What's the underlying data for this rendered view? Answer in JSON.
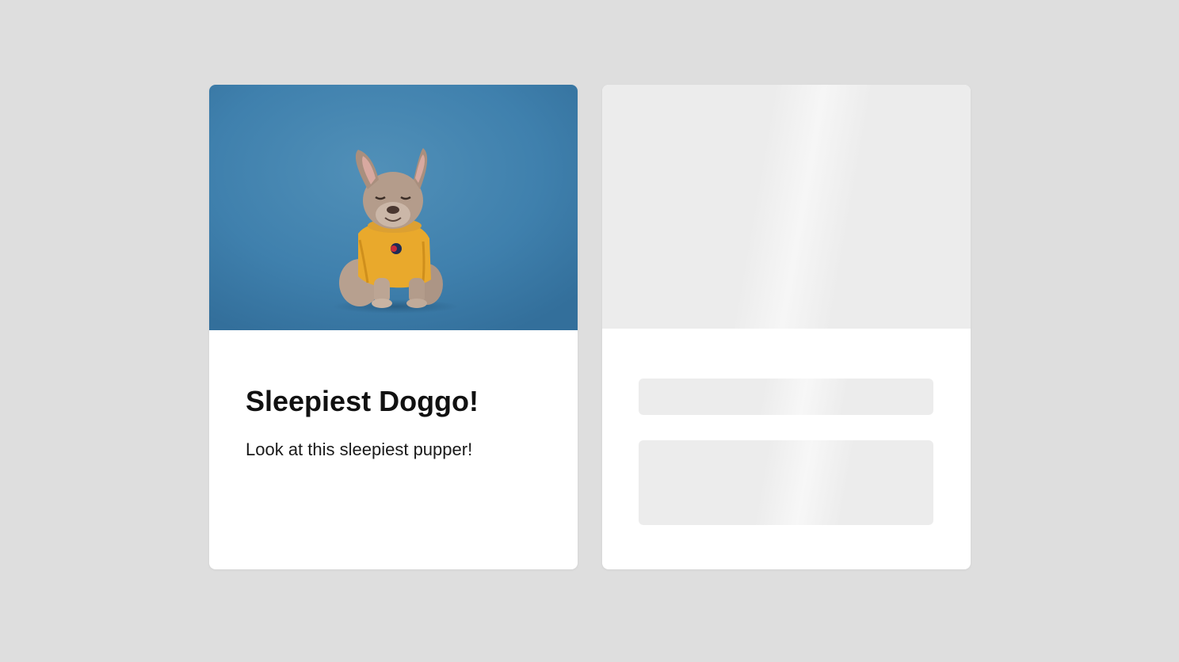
{
  "card": {
    "title": "Sleepiest Doggo!",
    "description": "Look at this sleepiest pupper!",
    "image": {
      "subject": "dog-photo",
      "background_color": "#3e7fab",
      "shirt_color": "#e9a92c"
    }
  },
  "skeleton_card": {
    "state": "loading",
    "base_color": "#ececec",
    "highlight_color": "#f7f7f7"
  },
  "colors": {
    "page_background": "#dedede",
    "card_background": "#ffffff"
  }
}
